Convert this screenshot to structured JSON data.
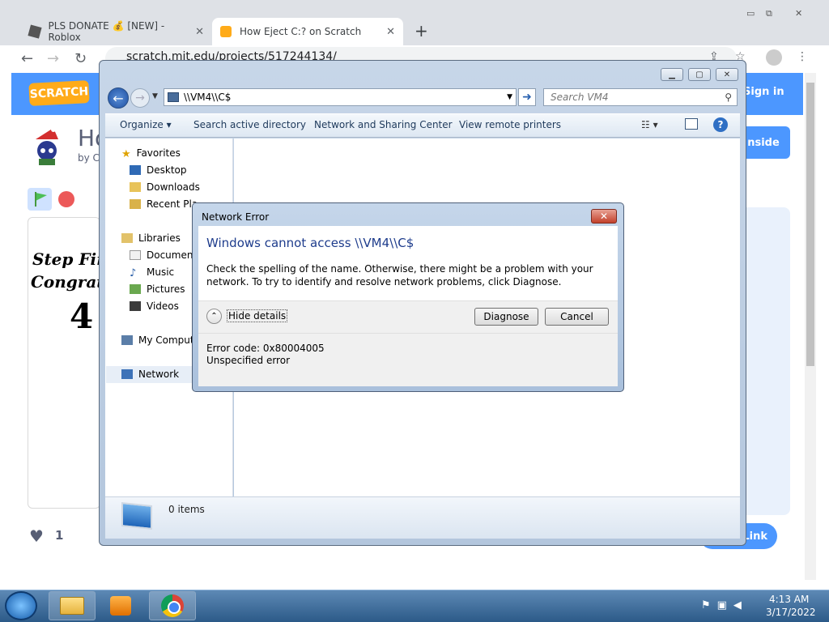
{
  "browser": {
    "tabs": [
      {
        "title": "PLS DONATE 💰 [NEW] - Roblox"
      },
      {
        "title": "How Eject C:? on Scratch"
      }
    ],
    "url": "scratch.mit.edu/projects/517244134/"
  },
  "scratch": {
    "logo": "SCRATCH",
    "sign_in": "Sign in",
    "see_inside": "nside",
    "title_fragment": "Ho",
    "by_fragment": "by C",
    "stage_text_line1": "Step Fin",
    "stage_text_line2": "Congratu",
    "stage_text_line3": "4",
    "love_count": "1",
    "copy_link": "Link"
  },
  "explorer": {
    "address": "\\\\VM4\\\\C$",
    "search_placeholder": "Search VM4",
    "commands": [
      "Organize ▾",
      "Search active directory",
      "Network and Sharing Center",
      "View remote printers"
    ],
    "nav": {
      "favorites": "Favorites",
      "desktop": "Desktop",
      "downloads": "Downloads",
      "recent": "Recent Pla",
      "libraries": "Libraries",
      "documents": "Document",
      "music": "Music",
      "pictures": "Pictures",
      "videos": "Videos",
      "computer": "My Compute",
      "network": "Network"
    },
    "status": "0 items"
  },
  "dialog": {
    "title": "Network Error",
    "main": "Windows cannot access \\\\VM4\\\\C$",
    "message": "Check the spelling of the name. Otherwise, there might be a problem with your network. To try to identify and resolve network problems, click Diagnose.",
    "hide_details": "Hide details",
    "diagnose": "Diagnose",
    "cancel": "Cancel",
    "error_code": "Error code: 0x80004005",
    "error_text": "Unspecified error"
  },
  "taskbar": {
    "time": "4:13 AM",
    "date": "3/17/2022"
  },
  "colors": {
    "scratch_blue": "#4c97ff",
    "dialog_heading": "#1e3c8c",
    "close_red": "#c3412b"
  }
}
